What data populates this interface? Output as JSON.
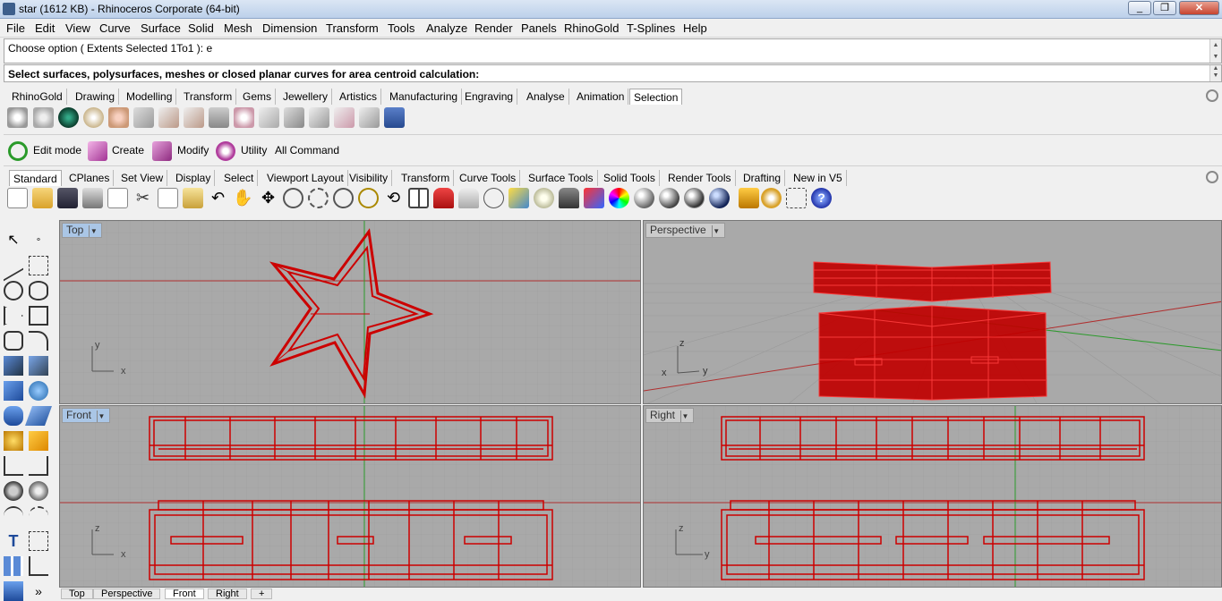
{
  "titlebar": {
    "title": "star (1612 KB) - Rhinoceros Corporate (64-bit)",
    "buttons": [
      "minimize-icon",
      "restore-icon",
      "close-icon"
    ]
  },
  "menubar": {
    "items": [
      "File",
      "Edit",
      "View",
      "Curve",
      "Surface",
      "Solid",
      "Mesh",
      "Dimension",
      "Transform",
      "Tools",
      "Analyze",
      "Render",
      "Panels",
      "RhinoGold",
      "T-Splines",
      "Help"
    ]
  },
  "command": {
    "history": "Choose option ( Extents  Selected  1To1 ): e",
    "prompt": "Select surfaces, polysurfaces, meshes or closed planar curves for area centroid calculation:"
  },
  "rhinogold_tabs": {
    "items": [
      "RhinoGold",
      "Drawing",
      "Modelling",
      "Transform",
      "Gems",
      "Jewellery",
      "Artistics",
      "Manufacturing",
      "Engraving",
      "Analyse",
      "Animation",
      "Selection"
    ],
    "active": "Selection"
  },
  "panel_toolbar": {
    "items": [
      "Edit mode",
      "Create",
      "Modify",
      "Utility",
      "All Command"
    ]
  },
  "standard_tabs": {
    "items": [
      "Standard",
      "CPlanes",
      "Set View",
      "Display",
      "Select",
      "Viewport Layout",
      "Visibility",
      "Transform",
      "Curve Tools",
      "Surface Tools",
      "Solid Tools",
      "Render Tools",
      "Drafting",
      "New in V5"
    ],
    "active": "Standard"
  },
  "viewports": {
    "top": {
      "label": "Top",
      "axis_x": "x",
      "axis_y": "y"
    },
    "perspective": {
      "label": "Perspective",
      "axis_x": "x",
      "axis_y": "y",
      "axis_z": "z"
    },
    "front": {
      "label": "Front",
      "axis_x": "x",
      "axis_z": "z"
    },
    "right": {
      "label": "Right",
      "axis_x": "y",
      "axis_z": "z"
    }
  },
  "viewport_tabs": {
    "items": [
      "Top",
      "Perspective",
      "Front",
      "Right"
    ],
    "active": "Front",
    "add": "+"
  },
  "colors": {
    "object": "#cc0000",
    "viewport_bg": "#a9a9a9",
    "grid": "#9a9a9a",
    "axis_x": "#b03030",
    "axis_y": "#2a9a2a"
  }
}
